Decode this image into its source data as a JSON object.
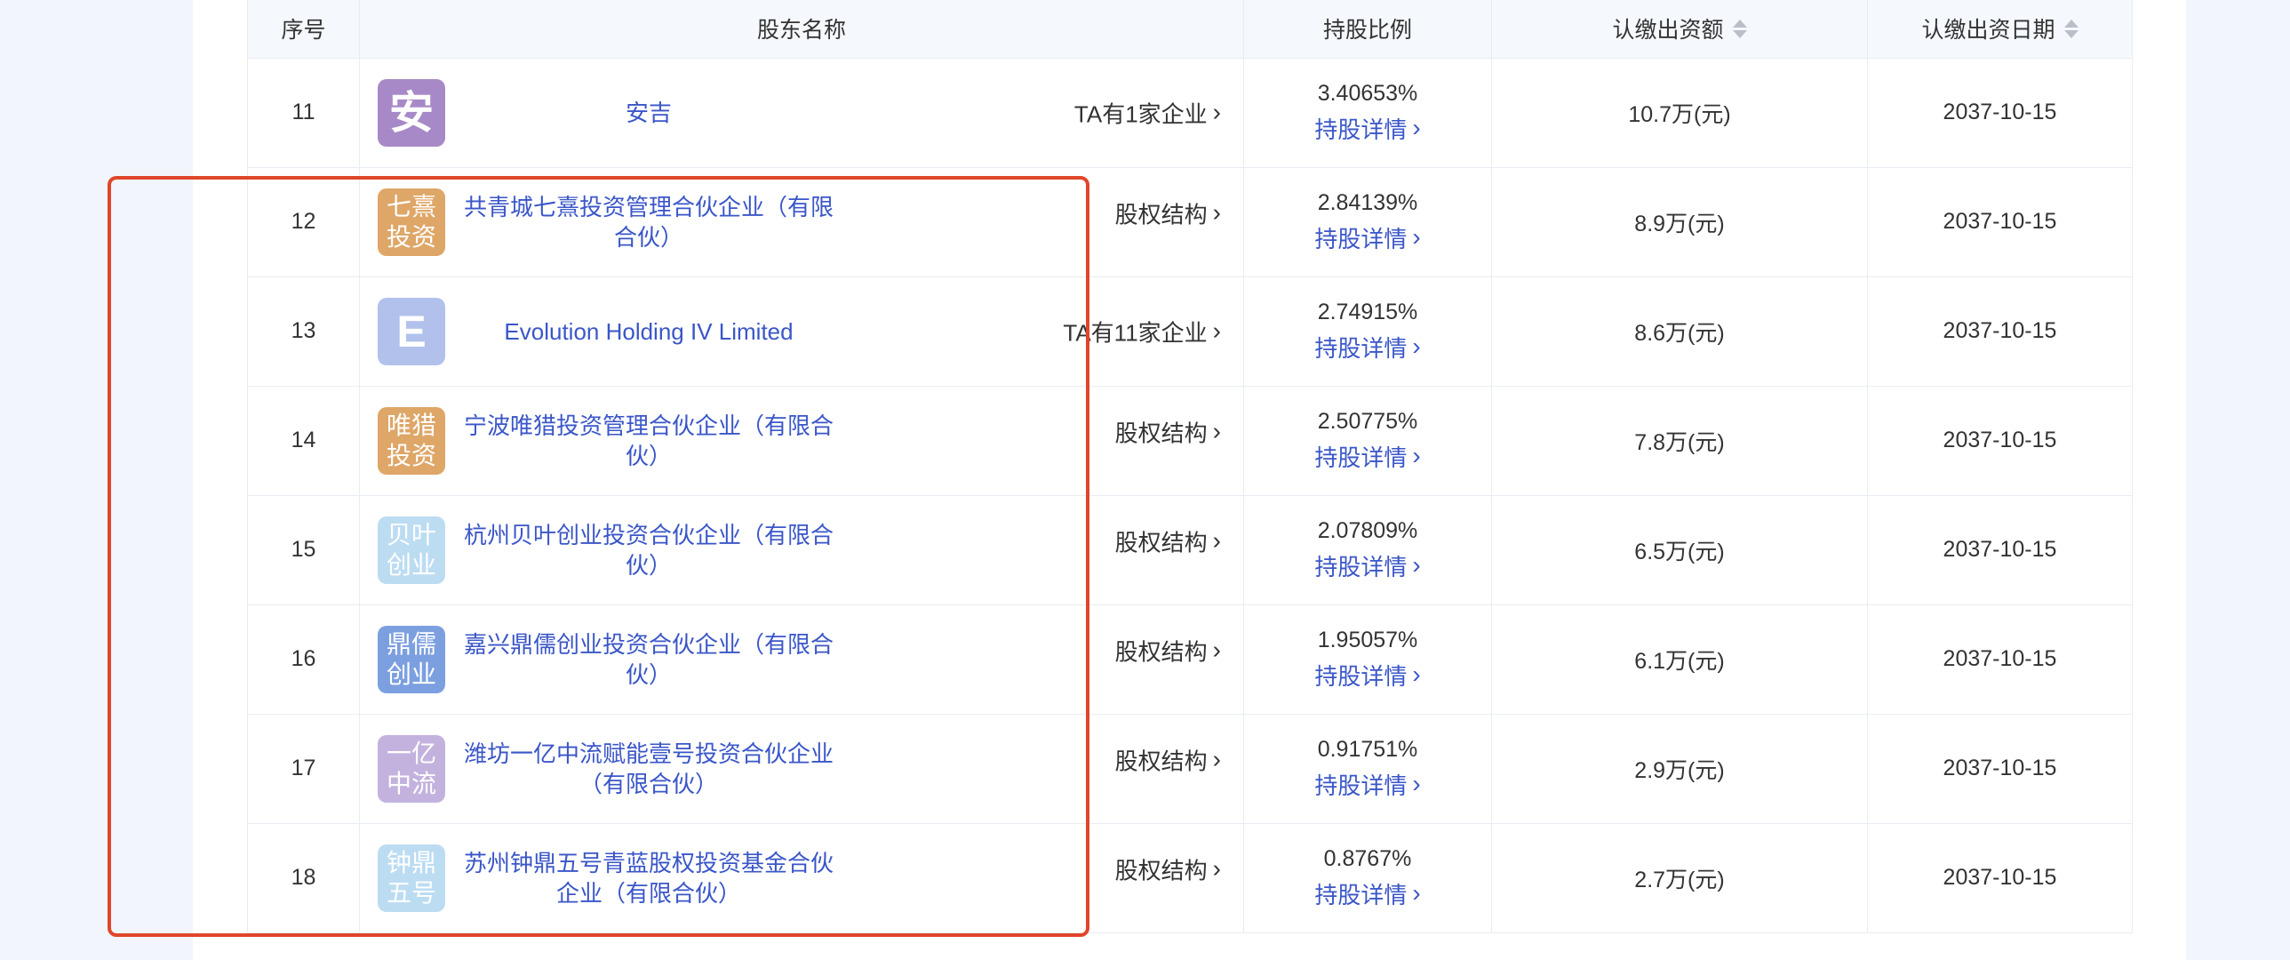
{
  "colors": {
    "accent": "#3a56c8",
    "highlight": "#e0462a"
  },
  "table": {
    "headers": {
      "index": "序号",
      "name": "股东名称",
      "ratio": "持股比例",
      "amount": "认缴出资额",
      "date": "认缴出资日期"
    },
    "detail_label": "持股详情",
    "rows": [
      {
        "index": "11",
        "logo": "安",
        "logo_color": "#a889c7",
        "name": "安吉",
        "link": "TA有1家企业",
        "ratio": "3.40653%",
        "amount": "10.7万(元)",
        "date": "2037-10-15"
      },
      {
        "index": "12",
        "logo": "七熹投资",
        "logo_color": "#dea667",
        "name": "共青城七熹投资管理合伙企业（有限合伙）",
        "link": "股权结构",
        "ratio": "2.84139%",
        "amount": "8.9万(元)",
        "date": "2037-10-15"
      },
      {
        "index": "13",
        "logo": "E",
        "logo_color": "#b1c1ec",
        "name": "Evolution Holding IV Limited",
        "link": "TA有11家企业",
        "ratio": "2.74915%",
        "amount": "8.6万(元)",
        "date": "2037-10-15"
      },
      {
        "index": "14",
        "logo": "唯猎投资",
        "logo_color": "#dea667",
        "name": "宁波唯猎投资管理合伙企业（有限合伙）",
        "link": "股权结构",
        "ratio": "2.50775%",
        "amount": "7.8万(元)",
        "date": "2037-10-15"
      },
      {
        "index": "15",
        "logo": "贝叶创业",
        "logo_color": "#bcdcf2",
        "name": "杭州贝叶创业投资合伙企业（有限合伙）",
        "link": "股权结构",
        "ratio": "2.07809%",
        "amount": "6.5万(元)",
        "date": "2037-10-15"
      },
      {
        "index": "16",
        "logo": "鼎儒创业",
        "logo_color": "#7c9fe0",
        "name": "嘉兴鼎儒创业投资合伙企业（有限合伙）",
        "link": "股权结构",
        "ratio": "1.95057%",
        "amount": "6.1万(元)",
        "date": "2037-10-15"
      },
      {
        "index": "17",
        "logo": "一亿中流",
        "logo_color": "#c3b2de",
        "name": "潍坊一亿中流赋能壹号投资合伙企业（有限合伙）",
        "link": "股权结构",
        "ratio": "0.91751%",
        "amount": "2.9万(元)",
        "date": "2037-10-15"
      },
      {
        "index": "18",
        "logo": "钟鼎五号",
        "logo_color": "#bcdcf2",
        "name": "苏州钟鼎五号青蓝股权投资基金合伙企业（有限合伙）",
        "link": "股权结构",
        "ratio": "0.8767%",
        "amount": "2.7万(元)",
        "date": "2037-10-15"
      }
    ]
  }
}
